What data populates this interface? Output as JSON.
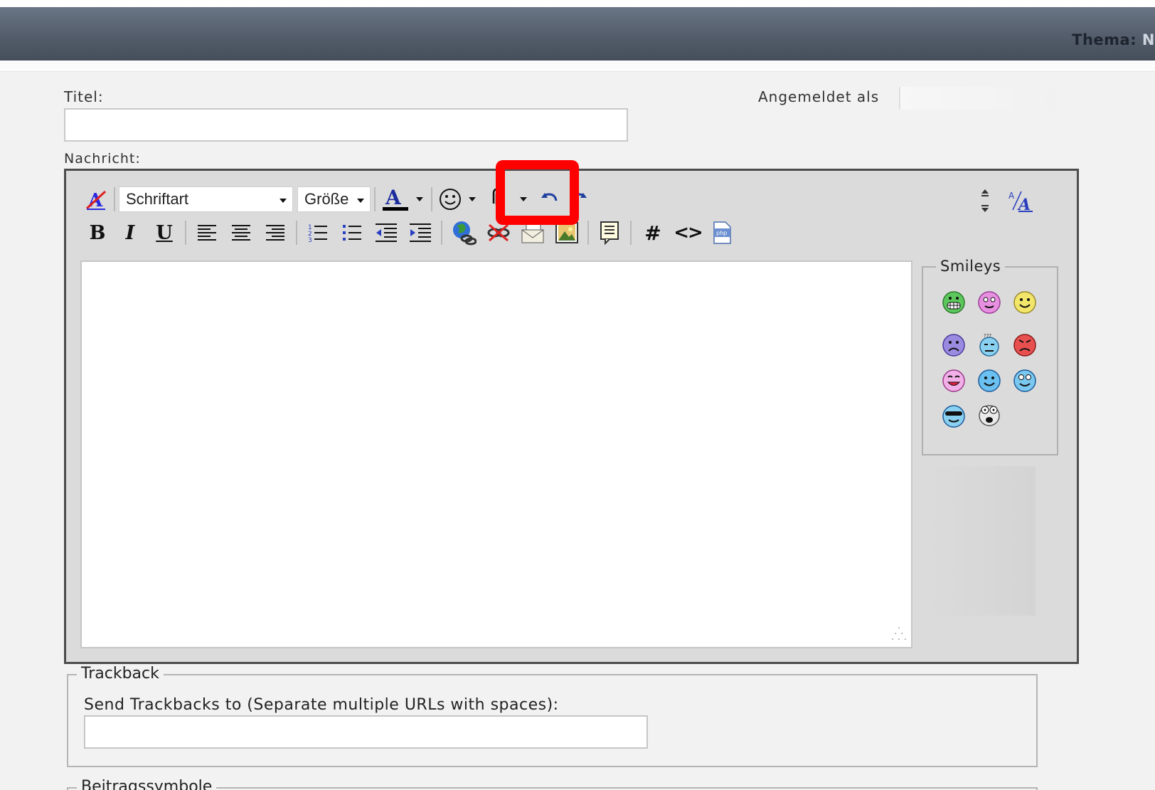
{
  "header": {
    "theme_label": "Thema:",
    "theme_value": "N"
  },
  "form": {
    "title_label": "Titel:",
    "title_value": "",
    "logged_in_label": "Angemeldet als",
    "message_label": "Nachricht:"
  },
  "toolbar": {
    "font_select": "Schriftart",
    "size_select": "Größe",
    "icons": [
      "remove-format",
      "font-color",
      "emoticons",
      "attachment",
      "undo",
      "redo",
      "resize-toggle",
      "text-direction",
      "bold",
      "italic",
      "underline",
      "align-left",
      "align-center",
      "align-right",
      "ordered-list",
      "unordered-list",
      "outdent",
      "indent",
      "insert-link",
      "unlink",
      "insert-email",
      "insert-image",
      "insert-quote",
      "hashtag",
      "code",
      "php"
    ],
    "bold_label": "B",
    "italic_label": "I",
    "underline_label": "U",
    "hash_label": "#",
    "code_label": "<>",
    "font_color_label": "A",
    "php_label": "php"
  },
  "smileys": {
    "legend": "Smileys",
    "items": [
      "grin",
      "blush",
      "smile",
      "sad",
      "confused",
      "angry",
      "tongue",
      "happy",
      "wink",
      "cool",
      "shocked"
    ],
    "confused_marker": "???"
  },
  "trackback": {
    "legend": "Trackback",
    "label": "Send Trackbacks to (Separate multiple URLs with spaces):",
    "value": ""
  },
  "post_icons": {
    "legend": "Beitragssymbole"
  },
  "colors": {
    "highlight": "#ff0000",
    "header": "#535d6b"
  }
}
